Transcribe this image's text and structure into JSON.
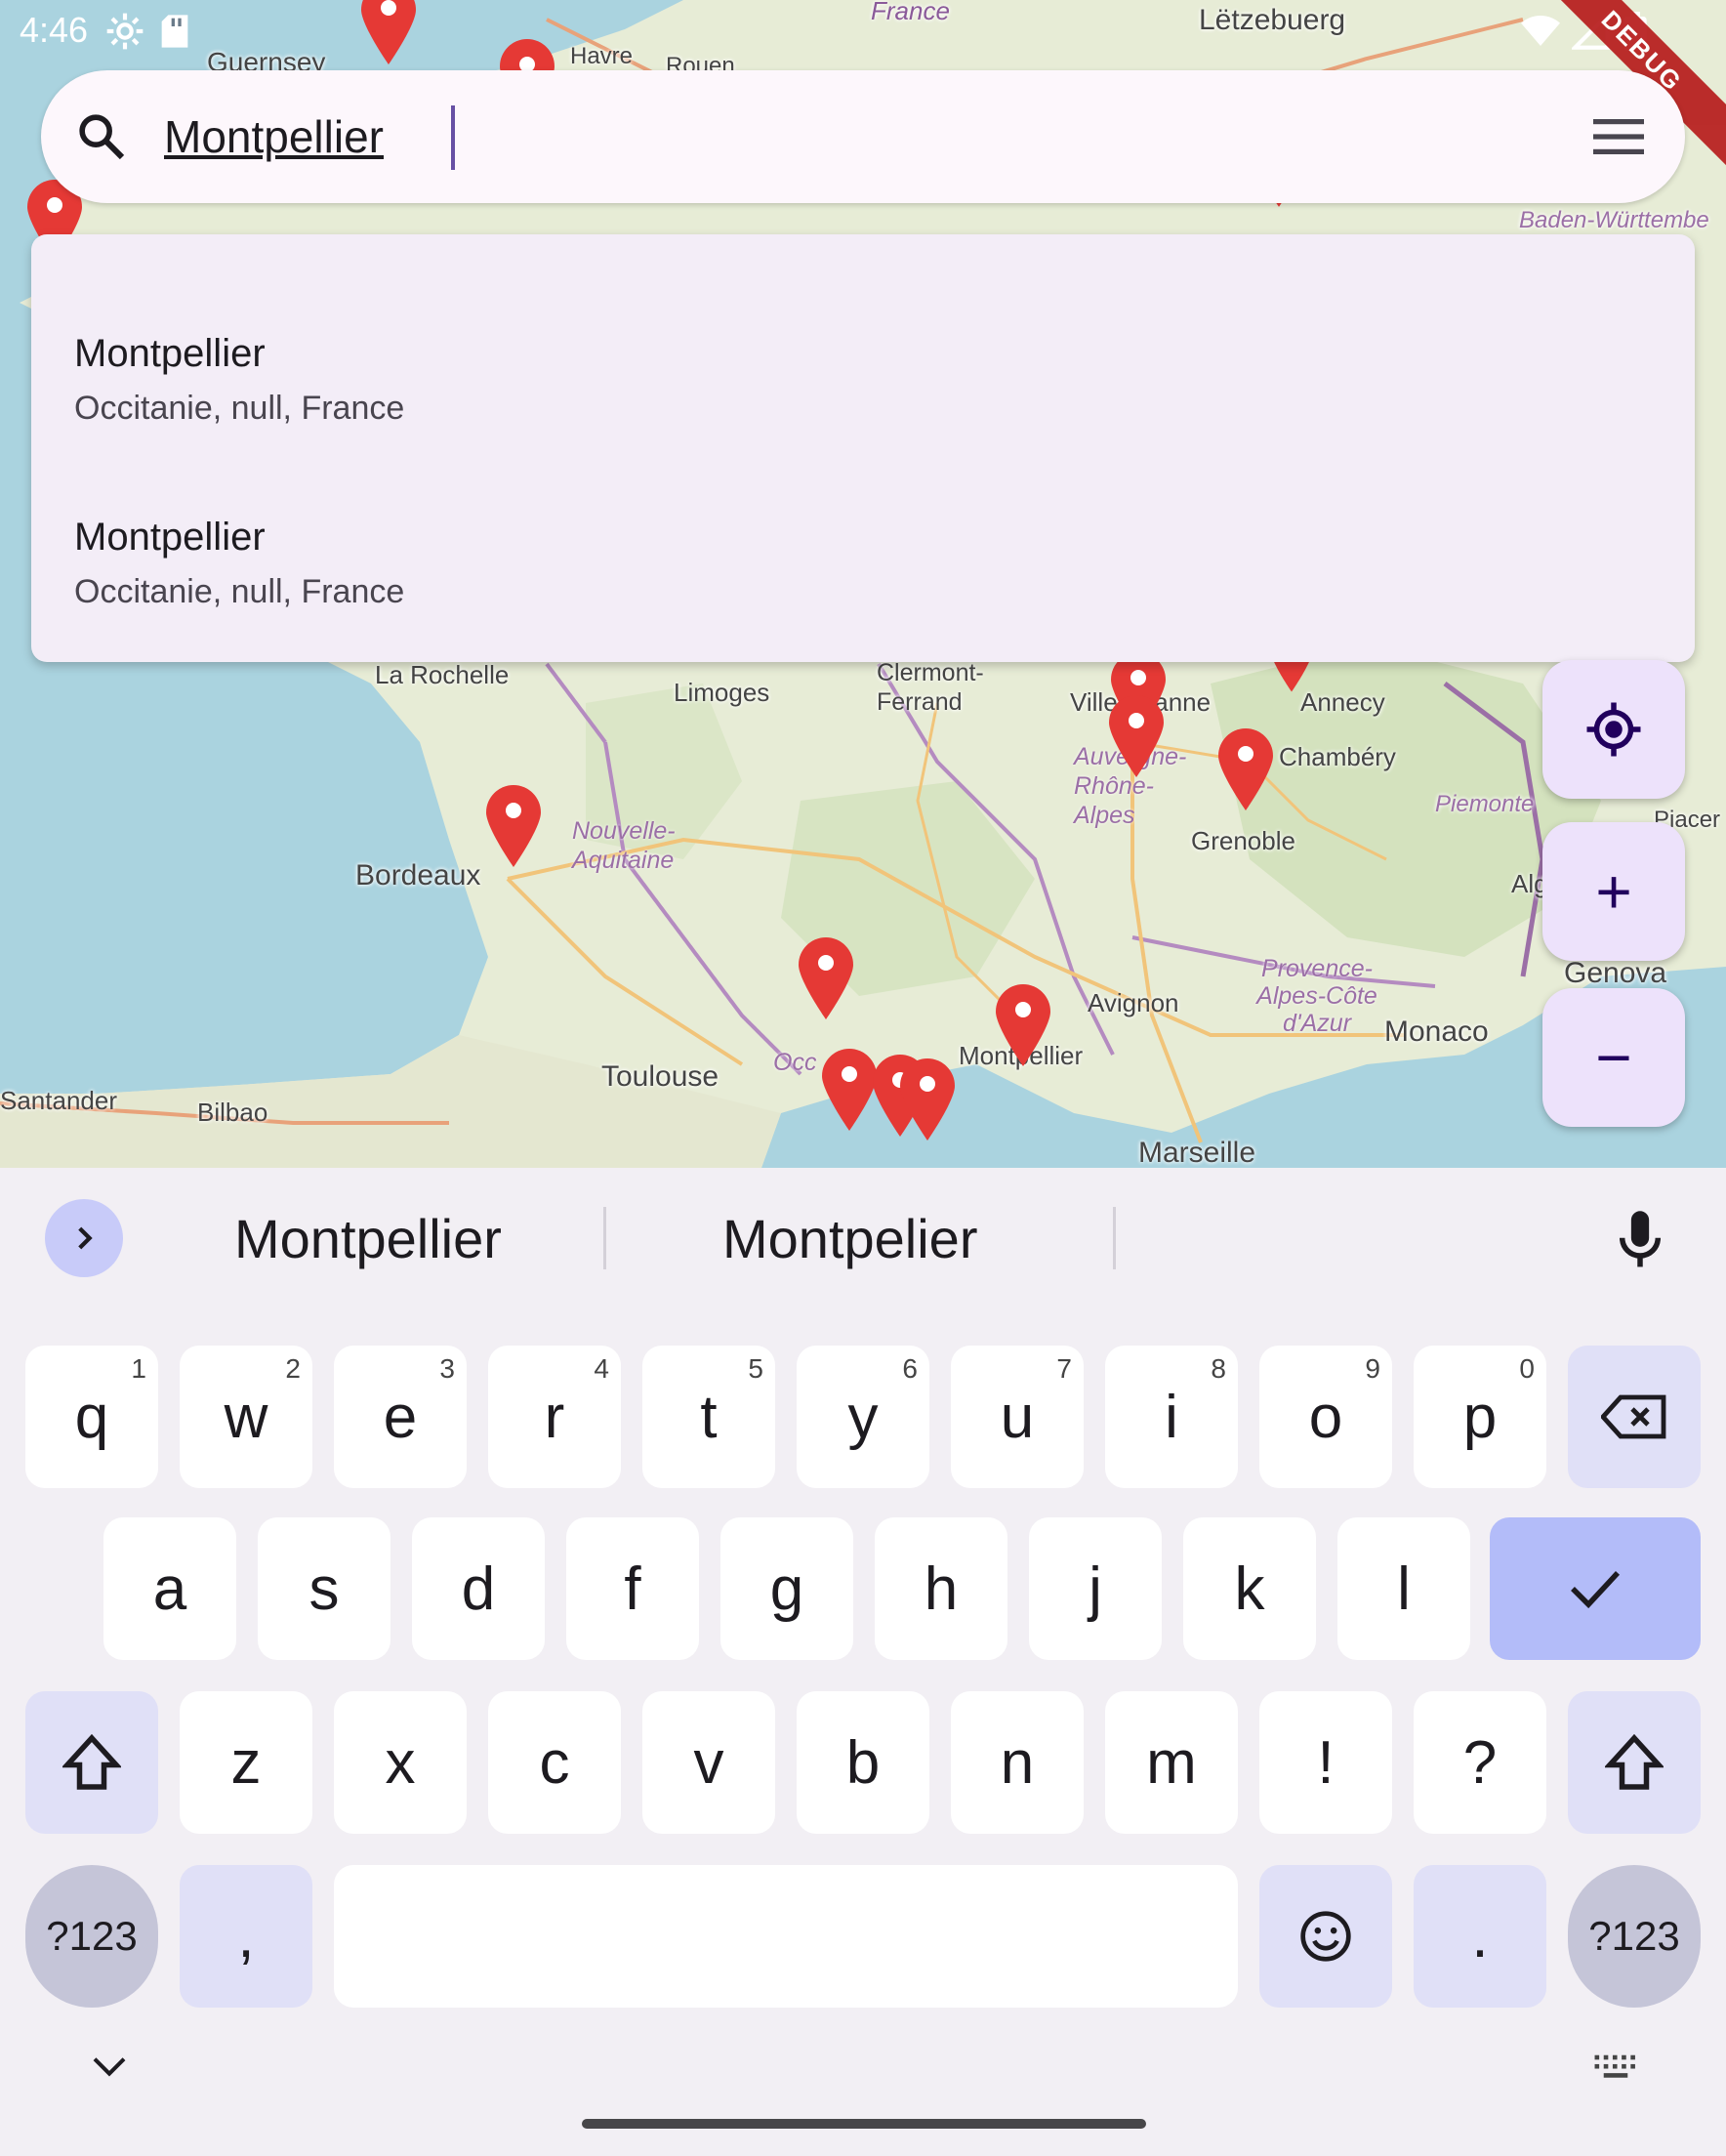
{
  "status_bar": {
    "time": "4:46",
    "debug_ribbon": "DEBUG"
  },
  "map": {
    "places": [
      "Guernsey",
      "Havre",
      "Rouen",
      "France",
      "Lëtzebuerg",
      "Baden-Württembe",
      "La Rochelle",
      "Limoges",
      "Clermont-Ferrand",
      "Villeurbanne",
      "Annecy",
      "Chambéry",
      "Grenoble",
      "Piemonte",
      "Bordeaux",
      "Toulouse",
      "Montpellier",
      "Avignon",
      "Monaco",
      "Genova",
      "Marseille",
      "Santander",
      "Bilbao",
      "Alg",
      "Piacer"
    ],
    "regions": [
      "Nouvelle-Aquitaine",
      "Auvergne-Rhône-Alpes",
      "Provence-Alpes-Côte d'Azur",
      "Occ"
    ],
    "pin_color": "#e53935",
    "water_color": "#aad3df",
    "land_color": "#e7ecd6"
  },
  "search": {
    "value": "Montpellier",
    "icon": "search-icon",
    "menu_icon": "menu-icon"
  },
  "suggestions": [
    {
      "title": "Montpellier",
      "subtitle": "Occitanie, null, France"
    },
    {
      "title": "Montpellier",
      "subtitle": "Occitanie, null, France"
    }
  ],
  "fabs": {
    "locate_icon": "my-location-icon",
    "zoom_in_label": "+",
    "zoom_out_label": "−"
  },
  "keyboard": {
    "suggestions": [
      "Montpellier",
      "Montpelier"
    ],
    "row1": [
      {
        "k": "q",
        "n": "1"
      },
      {
        "k": "w",
        "n": "2"
      },
      {
        "k": "e",
        "n": "3"
      },
      {
        "k": "r",
        "n": "4"
      },
      {
        "k": "t",
        "n": "5"
      },
      {
        "k": "y",
        "n": "6"
      },
      {
        "k": "u",
        "n": "7"
      },
      {
        "k": "i",
        "n": "8"
      },
      {
        "k": "o",
        "n": "9"
      },
      {
        "k": "p",
        "n": "0"
      }
    ],
    "row2": [
      "a",
      "s",
      "d",
      "f",
      "g",
      "h",
      "j",
      "k",
      "l"
    ],
    "row3": [
      "z",
      "x",
      "c",
      "v",
      "b",
      "n",
      "m",
      "!",
      "?"
    ],
    "symbols_label": "?123",
    "comma_label": ",",
    "period_label": "."
  },
  "accent_color": "#6750a4"
}
